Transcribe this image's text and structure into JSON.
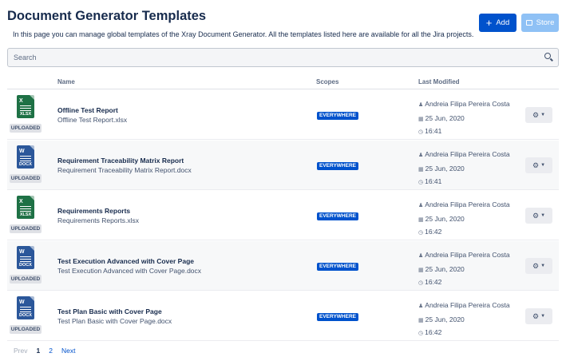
{
  "header": {
    "title": "Document Generator Templates",
    "subtitle": "In this page you can manage global templates of the Xray Document Generator. All the templates listed here are available for all the Jira projects.",
    "add_label": "Add",
    "store_label": "Store"
  },
  "search": {
    "placeholder": "Search"
  },
  "columns": {
    "name": "Name",
    "scopes": "Scopes",
    "last_modified": "Last Modified"
  },
  "templates": [
    {
      "icon": "xlsx-file-icon",
      "ext": "XLSX",
      "status": "UPLOADED",
      "name": "Offline Test Report",
      "file": "Offline Test Report.xlsx",
      "scope": "EVERYWHERE",
      "author": "Andreia Filipa Pereira Costa",
      "date": "25 Jun, 2020",
      "time": "16:41"
    },
    {
      "icon": "docx-file-icon",
      "ext": "DOCX",
      "status": "UPLOADED",
      "name": "Requirement Traceability Matrix Report",
      "file": "Requirement Traceability Matrix Report.docx",
      "scope": "EVERYWHERE",
      "author": "Andreia Filipa Pereira Costa",
      "date": "25 Jun, 2020",
      "time": "16:41"
    },
    {
      "icon": "xlsx-file-icon",
      "ext": "XLSX",
      "status": "UPLOADED",
      "name": "Requirements Reports",
      "file": "Requirements Reports.xlsx",
      "scope": "EVERYWHERE",
      "author": "Andreia Filipa Pereira Costa",
      "date": "25 Jun, 2020",
      "time": "16:42"
    },
    {
      "icon": "docx-file-icon",
      "ext": "DOCX",
      "status": "UPLOADED",
      "name": "Test Execution Advanced with Cover Page",
      "file": "Test Execution Advanced with Cover Page.docx",
      "scope": "EVERYWHERE",
      "author": "Andreia Filipa Pereira Costa",
      "date": "25 Jun, 2020",
      "time": "16:42"
    },
    {
      "icon": "docx-file-icon",
      "ext": "DOCX",
      "status": "UPLOADED",
      "name": "Test Plan Basic with Cover Page",
      "file": "Test Plan Basic with Cover Page.docx",
      "scope": "EVERYWHERE",
      "author": "Andreia Filipa Pereira Costa",
      "date": "25 Jun, 2020",
      "time": "16:42"
    }
  ],
  "pagination": {
    "prev": "Prev",
    "pages": [
      "1",
      "2"
    ],
    "current": "1",
    "next": "Next"
  },
  "colors": {
    "primary": "#0052cc",
    "store_disabled": "#8fc1f5",
    "xlsx": "#1e7145",
    "docx": "#2b579a"
  }
}
